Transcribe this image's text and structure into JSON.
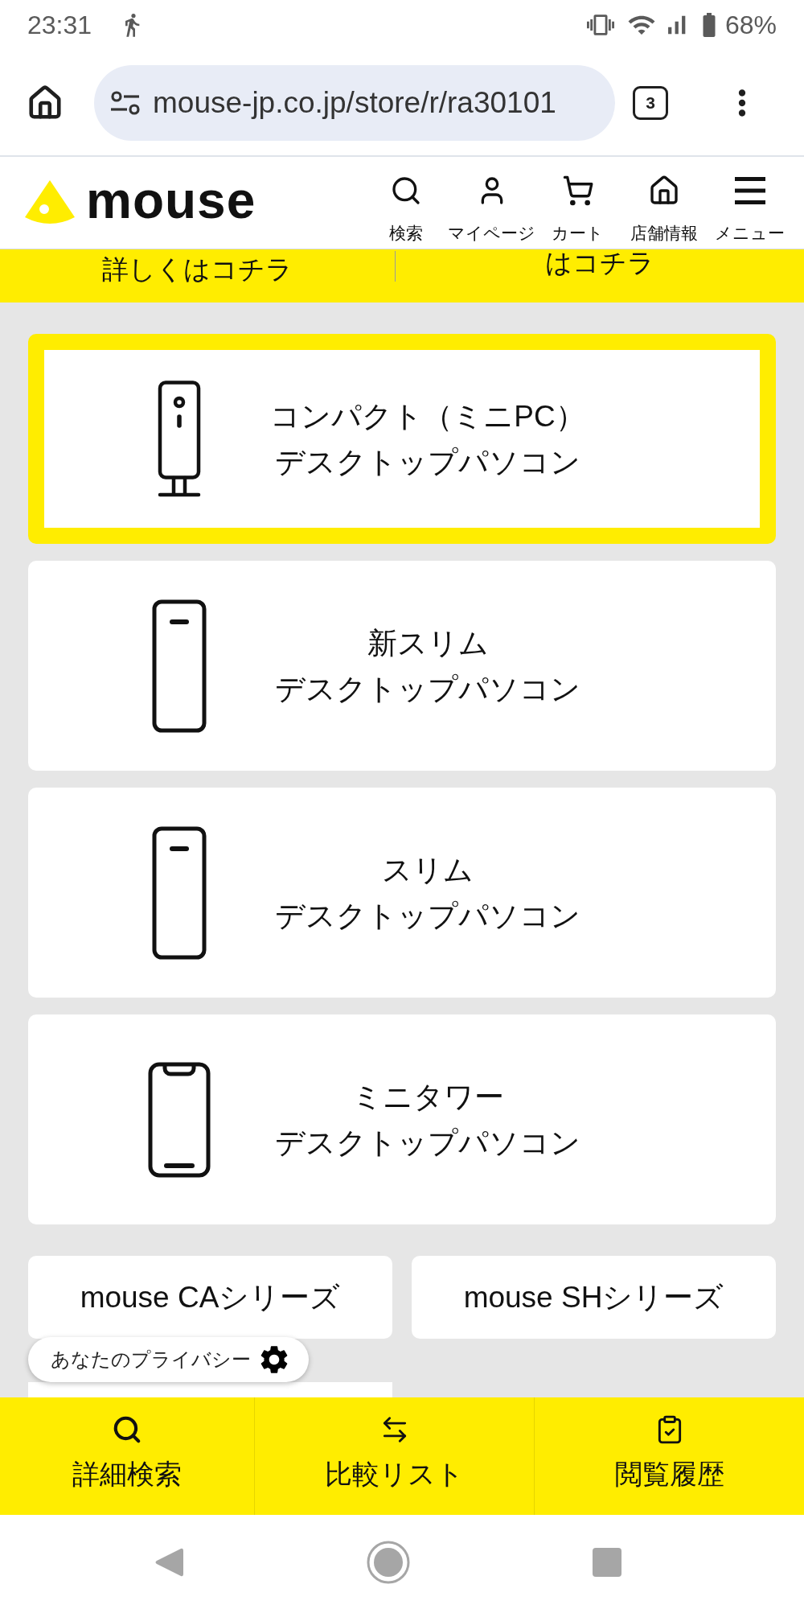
{
  "status_bar": {
    "time": "23:31",
    "battery": "68%"
  },
  "browser": {
    "url": "mouse-jp.co.jp/store/r/ra30101",
    "tab_count": "3"
  },
  "header": {
    "logo": "mouse",
    "nav": [
      {
        "label": "検索"
      },
      {
        "label": "マイページ"
      },
      {
        "label": "カート"
      },
      {
        "label": "店舗情報"
      },
      {
        "label": "メニュー"
      }
    ]
  },
  "banner": {
    "links": [
      "詳しくはコチラ",
      "はコチラ"
    ]
  },
  "categories": [
    {
      "kind": "compact",
      "selected": true,
      "lines": [
        "コンパクト（ミニPC）",
        "デスクトップパソコン"
      ]
    },
    {
      "kind": "slim",
      "selected": false,
      "lines": [
        "新スリム",
        "デスクトップパソコン"
      ]
    },
    {
      "kind": "slim",
      "selected": false,
      "lines": [
        "スリム",
        "デスクトップパソコン"
      ]
    },
    {
      "kind": "tower",
      "selected": false,
      "lines": [
        "ミニタワー",
        "デスクトップパソコン"
      ]
    }
  ],
  "series": {
    "buttons": [
      {
        "label": "mouse CAシリーズ"
      },
      {
        "label": "mouse SHシリーズ"
      }
    ],
    "next_row_partly_visible": true
  },
  "privacy_button": {
    "label": "あなたのプライバシー"
  },
  "bottom_bar": [
    {
      "label": "詳細検索"
    },
    {
      "label": "比較リスト"
    },
    {
      "label": "閲覧履歴"
    }
  ]
}
